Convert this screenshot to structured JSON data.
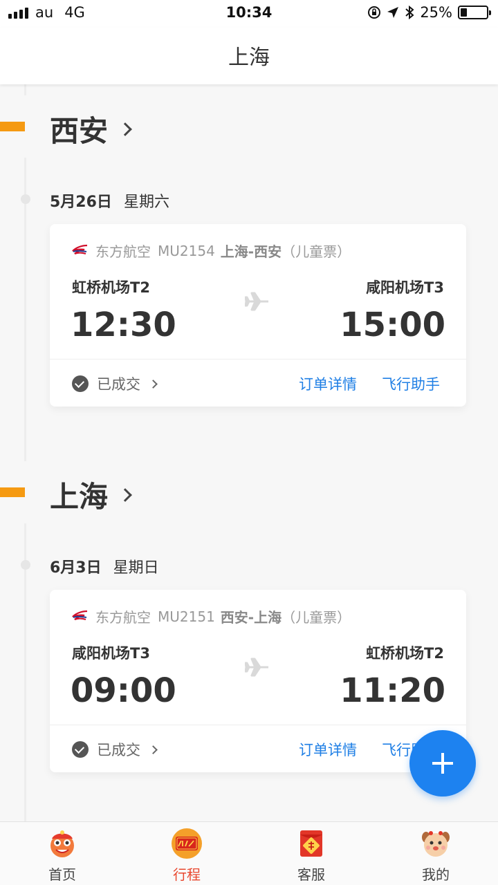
{
  "status_bar": {
    "carrier": "au",
    "network": "4G",
    "time": "10:34",
    "battery": "25%",
    "battery_level": 0.25
  },
  "header": {
    "title": "上海"
  },
  "trips": [
    {
      "city": "西安",
      "date": "5月26日",
      "weekday": "星期六",
      "flight": {
        "airline": "东方航空",
        "number": "MU2154",
        "route": "上海-西安",
        "ticket_type": "（儿童票）",
        "dep_airport": "虹桥机场T2",
        "arr_airport": "咸阳机场T3",
        "dep_time": "12:30",
        "arr_time": "15:00",
        "status": "已成交",
        "link_order": "订单详情",
        "link_assistant": "飞行助手"
      }
    },
    {
      "city": "上海",
      "date": "6月3日",
      "weekday": "星期日",
      "flight": {
        "airline": "东方航空",
        "number": "MU2151",
        "route": "西安-上海",
        "ticket_type": "（儿童票）",
        "dep_airport": "咸阳机场T3",
        "arr_airport": "虹桥机场T2",
        "dep_time": "09:00",
        "arr_time": "11:20",
        "status": "已成交",
        "link_order": "订单详情",
        "link_assistant": "飞行助手"
      }
    }
  ],
  "tabs": [
    {
      "label": "首页",
      "icon": "lion-dance-icon"
    },
    {
      "label": "行程",
      "icon": "2018-badge-icon",
      "active": true
    },
    {
      "label": "客服",
      "icon": "red-envelope-icon"
    },
    {
      "label": "我的",
      "icon": "dog-face-icon"
    }
  ],
  "colors": {
    "accent_blue": "#1f7fe5",
    "marker_orange": "#f59a12",
    "active_tab": "#e8472e"
  }
}
